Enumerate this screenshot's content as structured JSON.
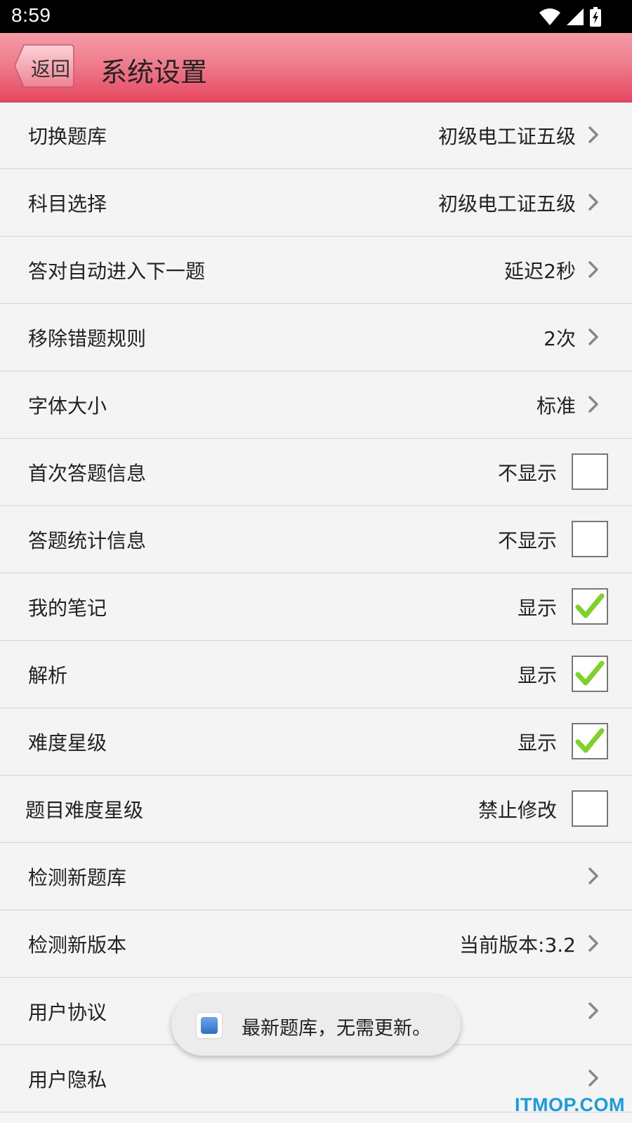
{
  "status_bar": {
    "time": "8:59"
  },
  "header": {
    "back_label": "返回",
    "title": "系统设置"
  },
  "settings": [
    {
      "label": "切换题库",
      "value": "初级电工证五级",
      "control": "chevron"
    },
    {
      "label": "科目选择",
      "value": "初级电工证五级",
      "control": "chevron"
    },
    {
      "label": "答对自动进入下一题",
      "value": "延迟2秒",
      "control": "chevron"
    },
    {
      "label": "移除错题规则",
      "value": "2次",
      "control": "chevron"
    },
    {
      "label": "字体大小",
      "value": "标准",
      "control": "chevron"
    },
    {
      "label": "首次答题信息",
      "value": "不显示",
      "control": "checkbox",
      "checked": false
    },
    {
      "label": "答题统计信息",
      "value": "不显示",
      "control": "checkbox",
      "checked": false
    },
    {
      "label": "我的笔记",
      "value": "显示",
      "control": "checkbox",
      "checked": true
    },
    {
      "label": "解析",
      "value": "显示",
      "control": "checkbox",
      "checked": true
    },
    {
      "label": "难度星级",
      "value": "显示",
      "control": "checkbox",
      "checked": true
    },
    {
      "label": "题目难度星级",
      "value": "禁止修改",
      "control": "checkbox",
      "checked": false
    },
    {
      "label": "检测新题库",
      "value": "",
      "control": "chevron"
    },
    {
      "label": "检测新版本",
      "value": "当前版本:3.2",
      "control": "chevron"
    },
    {
      "label": "用户协议",
      "value": "",
      "control": "chevron"
    },
    {
      "label": "用户隐私",
      "value": "",
      "control": "chevron"
    }
  ],
  "toast": {
    "text": "最新题库，无需更新。"
  },
  "watermark": "ITMOP.COM",
  "colors": {
    "header_top": "#f49ca7",
    "header_bottom": "#e5485f",
    "check_green": "#7fd12a",
    "watermark_blue": "#1a9be0"
  }
}
